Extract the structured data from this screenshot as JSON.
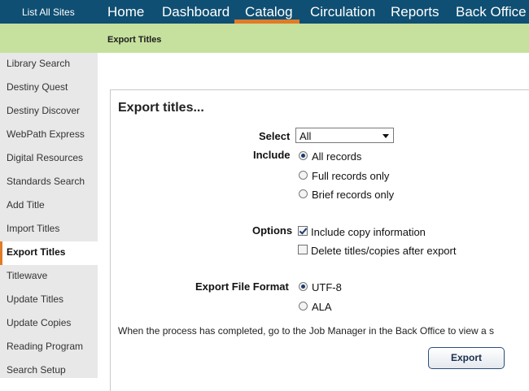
{
  "topbar": {
    "site_link": "List All Sites",
    "tabs": [
      {
        "label": "Home"
      },
      {
        "label": "Dashboard"
      },
      {
        "label": "Catalog"
      },
      {
        "label": "Circulation"
      },
      {
        "label": "Reports"
      },
      {
        "label": "Back Office"
      }
    ],
    "active_tab": "Catalog"
  },
  "subbar": {
    "title": "Export Titles"
  },
  "sidebar": {
    "items": [
      {
        "label": "Library Search"
      },
      {
        "label": "Destiny Quest"
      },
      {
        "label": "Destiny Discover"
      },
      {
        "label": "WebPath Express"
      },
      {
        "label": "Digital Resources"
      },
      {
        "label": "Standards Search"
      },
      {
        "label": "Add Title"
      },
      {
        "label": "Import Titles"
      },
      {
        "label": "Export Titles"
      },
      {
        "label": "Titlewave"
      },
      {
        "label": "Update Titles"
      },
      {
        "label": "Update Copies"
      },
      {
        "label": "Reading Program"
      },
      {
        "label": "Search Setup"
      }
    ],
    "active_item": "Export Titles"
  },
  "form": {
    "title": "Export titles...",
    "select_label": "Select",
    "select_value": "All",
    "include_label": "Include",
    "include_options": [
      {
        "label": "All records",
        "selected": true
      },
      {
        "label": "Full records only",
        "selected": false
      },
      {
        "label": "Brief records only",
        "selected": false
      }
    ],
    "options_label": "Options",
    "options": [
      {
        "label": "Include copy information",
        "checked": true
      },
      {
        "label": "Delete titles/copies after export",
        "checked": false
      }
    ],
    "format_label": "Export File Format",
    "format_options": [
      {
        "label": "UTF-8",
        "selected": true
      },
      {
        "label": "ALA",
        "selected": false
      }
    ],
    "note": "When the process has completed, go to the Job Manager in the Back Office to view a s",
    "export_button": "Export"
  },
  "colors": {
    "nav_bg": "#0f4f73",
    "accent": "#e07b28",
    "subbar_bg": "#c6e09e",
    "sidebar_bg": "#e8e8e8"
  }
}
